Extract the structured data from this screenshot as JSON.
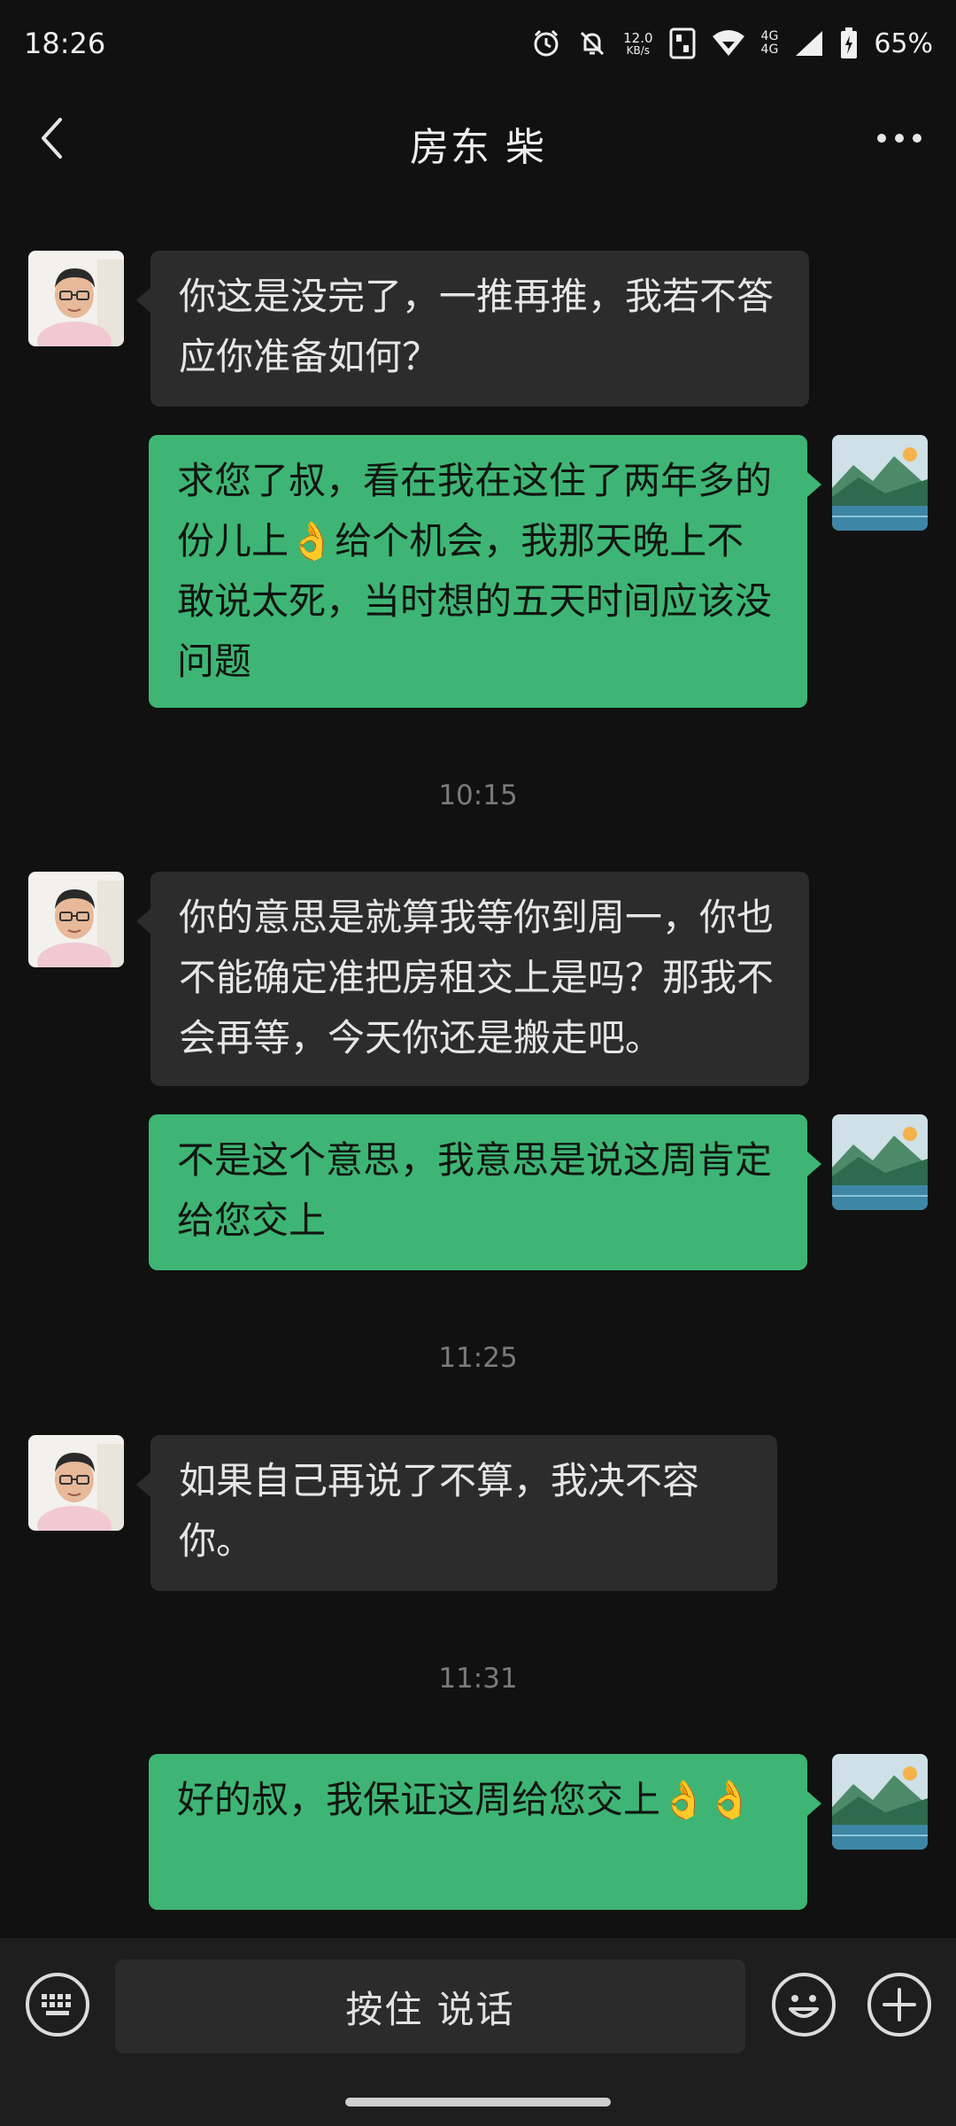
{
  "status_bar": {
    "time": "18:26",
    "net_speed_value": "12.0",
    "net_speed_unit": "KB/s",
    "signal_label_top": "4G",
    "signal_label_bottom": "4G",
    "battery": "65%"
  },
  "header": {
    "title": "房东 柴"
  },
  "messages": [
    {
      "side": "in",
      "text": "你这是没完了，一推再推，我若不答应你准备如何？"
    },
    {
      "side": "out",
      "text": "求您了叔，看在我在这住了两年多的份儿上👌给个机会，我那天晚上不敢说太死，当时想的五天时间应该没问题"
    },
    {
      "side": "time",
      "text": "10:15"
    },
    {
      "side": "in",
      "text": "你的意思是就算我等你到周一，你也不能确定准把房租交上是吗？那我不会再等，今天你还是搬走吧。"
    },
    {
      "side": "out",
      "text": "不是这个意思，我意思是说这周肯定给您交上"
    },
    {
      "side": "time",
      "text": "11:25"
    },
    {
      "side": "in",
      "text": "如果自己再说了不算，我决不容你。"
    },
    {
      "side": "time",
      "text": "11:31"
    },
    {
      "side": "out",
      "text": "好的叔，我保证这周给您交上👌👌"
    }
  ],
  "input_bar": {
    "voice_label": "按住 说话"
  },
  "icons": {
    "back": "chevron-left-icon",
    "more": "more-dots-icon",
    "keyboard": "keyboard-icon",
    "emoji": "emoji-icon",
    "plus": "plus-icon"
  },
  "colors": {
    "background": "#111111",
    "incoming_bubble": "#2c2c2c",
    "outgoing_bubble": "#3eb575",
    "timestamp": "#7a7a7a"
  }
}
